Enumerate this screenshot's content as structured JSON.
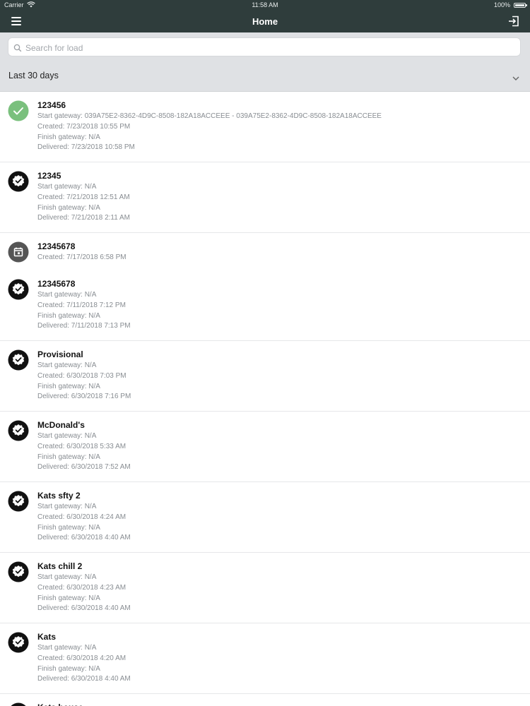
{
  "status_bar": {
    "carrier": "Carrier",
    "time": "11:58 AM",
    "battery": "100%"
  },
  "nav": {
    "title": "Home",
    "menu_icon": "hamburger-menu-icon",
    "logout_icon": "logout-icon"
  },
  "search": {
    "placeholder": "Search for load",
    "value": ""
  },
  "filter": {
    "label": "Last 30 days"
  },
  "colors": {
    "navbar": "#2f3d3c",
    "delivered_dark": "#111111",
    "delivered_green": "#7ac07d",
    "scheduled_gray": "#555555",
    "filter_bg": "#dfe1e4"
  },
  "loads": [
    {
      "title": "123456",
      "icon": "check-circle-green-icon",
      "lines": [
        "Start gateway: 039A75E2-8362-4D9C-8508-182A18ACCEEE - 039A75E2-8362-4D9C-8508-182A18ACCEEE",
        "Created: 7/23/2018 10:55 PM",
        "Finish gateway: N/A",
        "Delivered: 7/23/2018 10:58 PM"
      ]
    },
    {
      "title": "12345",
      "icon": "verified-badge-icon",
      "lines": [
        "Start gateway: N/A",
        "Created: 7/21/2018 12:51 AM",
        "Finish gateway: N/A",
        "Delivered: 7/21/2018 2:11 AM"
      ]
    },
    {
      "title": "12345678",
      "icon": "calendar-icon",
      "lines": [
        "Created: 7/17/2018 6:58 PM"
      ]
    },
    {
      "title": "12345678",
      "icon": "verified-badge-icon",
      "lines": [
        "Start gateway: N/A",
        "Created: 7/11/2018 7:12 PM",
        "Finish gateway: N/A",
        "Delivered: 7/11/2018 7:13 PM"
      ]
    },
    {
      "title": "Provisional",
      "icon": "verified-badge-icon",
      "lines": [
        "Start gateway: N/A",
        "Created: 6/30/2018 7:03 PM",
        "Finish gateway: N/A",
        "Delivered: 6/30/2018 7:16 PM"
      ]
    },
    {
      "title": "McDonald's",
      "icon": "verified-badge-icon",
      "lines": [
        "Start gateway: N/A",
        "Created: 6/30/2018 5:33 AM",
        "Finish gateway: N/A",
        "Delivered: 6/30/2018 7:52 AM"
      ]
    },
    {
      "title": "Kats sfty 2",
      "icon": "verified-badge-icon",
      "lines": [
        "Start gateway: N/A",
        "Created: 6/30/2018 4:24 AM",
        "Finish gateway: N/A",
        "Delivered: 6/30/2018 4:40 AM"
      ]
    },
    {
      "title": "Kats chill 2",
      "icon": "verified-badge-icon",
      "lines": [
        "Start gateway: N/A",
        "Created: 6/30/2018 4:23 AM",
        "Finish gateway: N/A",
        "Delivered: 6/30/2018 4:40 AM"
      ]
    },
    {
      "title": "Kats",
      "icon": "verified-badge-icon",
      "lines": [
        "Start gateway: N/A",
        "Created: 6/30/2018 4:20 AM",
        "Finish gateway: N/A",
        "Delivered: 6/30/2018 4:40 AM"
      ]
    },
    {
      "title": "Kats house",
      "icon": "verified-badge-icon",
      "lines": []
    }
  ]
}
